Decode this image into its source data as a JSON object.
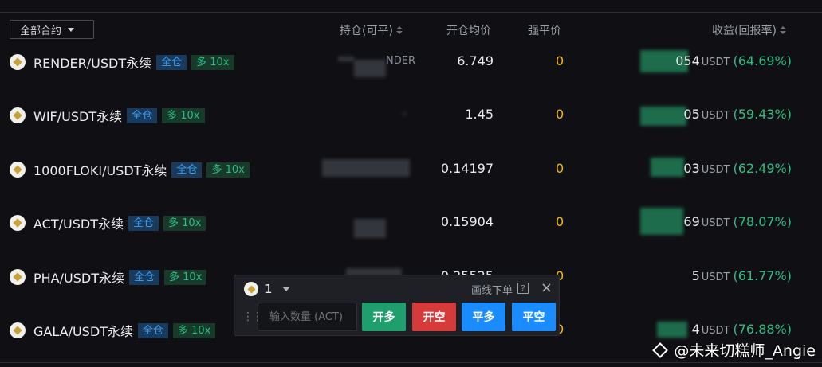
{
  "header": {
    "filter_label": "全部合约",
    "col_position": "持仓(可平)",
    "col_entry": "开仓均价",
    "col_liq": "强平价",
    "col_pnl": "收益(回报率)"
  },
  "rows": [
    {
      "symbol": "RENDER/USDT永续",
      "mode": "全仓",
      "leverage": "多 10x",
      "pos_text": "NDER",
      "entry": "6.749",
      "liq": "0",
      "pnl_amt": "054",
      "pnl_unit": "USDT",
      "pnl_pct": "(64.69%)"
    },
    {
      "symbol": "WIF/USDT永续",
      "mode": "全仓",
      "leverage": "多 10x",
      "pos_text": "",
      "entry": "1.45",
      "liq": "0",
      "pnl_amt": "05",
      "pnl_unit": "USDT",
      "pnl_pct": "(59.43%)"
    },
    {
      "symbol": "1000FLOKI/USDT永续",
      "mode": "全仓",
      "leverage": "多 10x",
      "pos_text": "",
      "entry": "0.14197",
      "liq": "0",
      "pnl_amt": "03",
      "pnl_unit": "USDT",
      "pnl_pct": "(62.49%)"
    },
    {
      "symbol": "ACT/USDT永续",
      "mode": "全仓",
      "leverage": "多 10x",
      "pos_text": "",
      "entry": "0.15904",
      "liq": "0",
      "pnl_amt": "69",
      "pnl_unit": "USDT",
      "pnl_pct": "(78.07%)"
    },
    {
      "symbol": "PHA/USDT永续",
      "mode": "全仓",
      "leverage": "多 10x",
      "pos_text": "",
      "entry": "0.25525",
      "liq": "0",
      "pnl_amt": "5",
      "pnl_unit": "USDT",
      "pnl_pct": "(61.77%)"
    },
    {
      "symbol": "GALA/USDT永续",
      "mode": "全仓",
      "leverage": "多 10x",
      "pos_text": "",
      "entry": "",
      "liq": "0",
      "pnl_amt": "4",
      "pnl_unit": "USDT",
      "pnl_pct": "(76.88%)"
    }
  ],
  "popup": {
    "multiplier": "1",
    "draw_order_label": "画线下单",
    "help_icon": "?",
    "close_icon": "×",
    "qty_placeholder": "输入数量 (ACT)",
    "btn_open_long": "开多",
    "btn_open_short": "开空",
    "btn_close_long": "平多",
    "btn_close_short": "平空"
  },
  "watermark": "@未来切糕师_Angie",
  "colors": {
    "accent_green": "#2ebd85",
    "accent_red": "#d63b3b",
    "accent_blue": "#1a8cff",
    "liq_yellow": "#f0b90b"
  }
}
